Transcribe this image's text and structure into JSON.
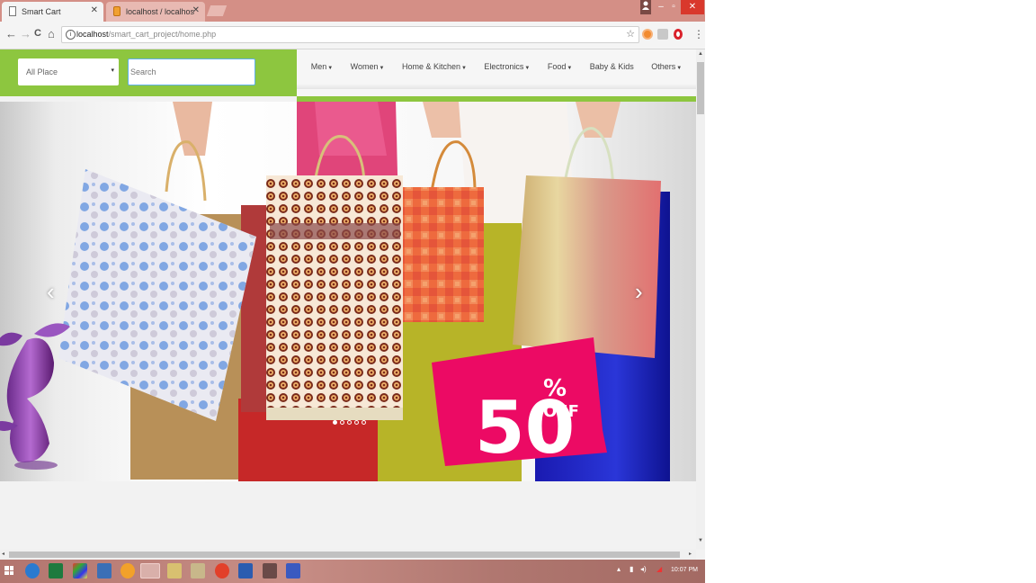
{
  "browser": {
    "tabs": [
      {
        "title": "Smart Cart",
        "active": true
      },
      {
        "title": "localhost / localhost | php",
        "active": false
      }
    ],
    "address": {
      "host": "localhost",
      "path": "/smart_cart_project/home.php"
    },
    "nav": {
      "back": "←",
      "forward": "→",
      "reload": "C",
      "home": "⌂"
    },
    "window_controls": {
      "minimize": "–",
      "maximize": "▫",
      "close": "✕"
    },
    "star": "☆",
    "menu": "⋮",
    "info": "i"
  },
  "header": {
    "place_select": {
      "value": "All Place",
      "caret": "▾"
    },
    "search": {
      "placeholder": "Search"
    },
    "menu": [
      {
        "label": "Men",
        "dropdown": true
      },
      {
        "label": "Women",
        "dropdown": true
      },
      {
        "label": "Home & Kitchen",
        "dropdown": true
      },
      {
        "label": "Electronics",
        "dropdown": true
      },
      {
        "label": "Food",
        "dropdown": true
      },
      {
        "label": "Baby & Kids",
        "dropdown": false
      },
      {
        "label": "Others",
        "dropdown": true
      }
    ]
  },
  "carousel": {
    "prev": "‹",
    "next": "›",
    "slide_count": 5,
    "active_slide": 0,
    "promo": {
      "number": "50",
      "percent": "%",
      "off": "OFF"
    }
  },
  "scrollbars": {
    "up": "▲",
    "down": "▼",
    "left": "◂",
    "right": "▸"
  },
  "taskbar": {
    "clock": "10:07 PM"
  },
  "colors": {
    "brand_green": "#8dc63f",
    "promo_pink": "#ec0a64",
    "tab_bar": "#d48f86",
    "window_close": "#d9382c"
  }
}
